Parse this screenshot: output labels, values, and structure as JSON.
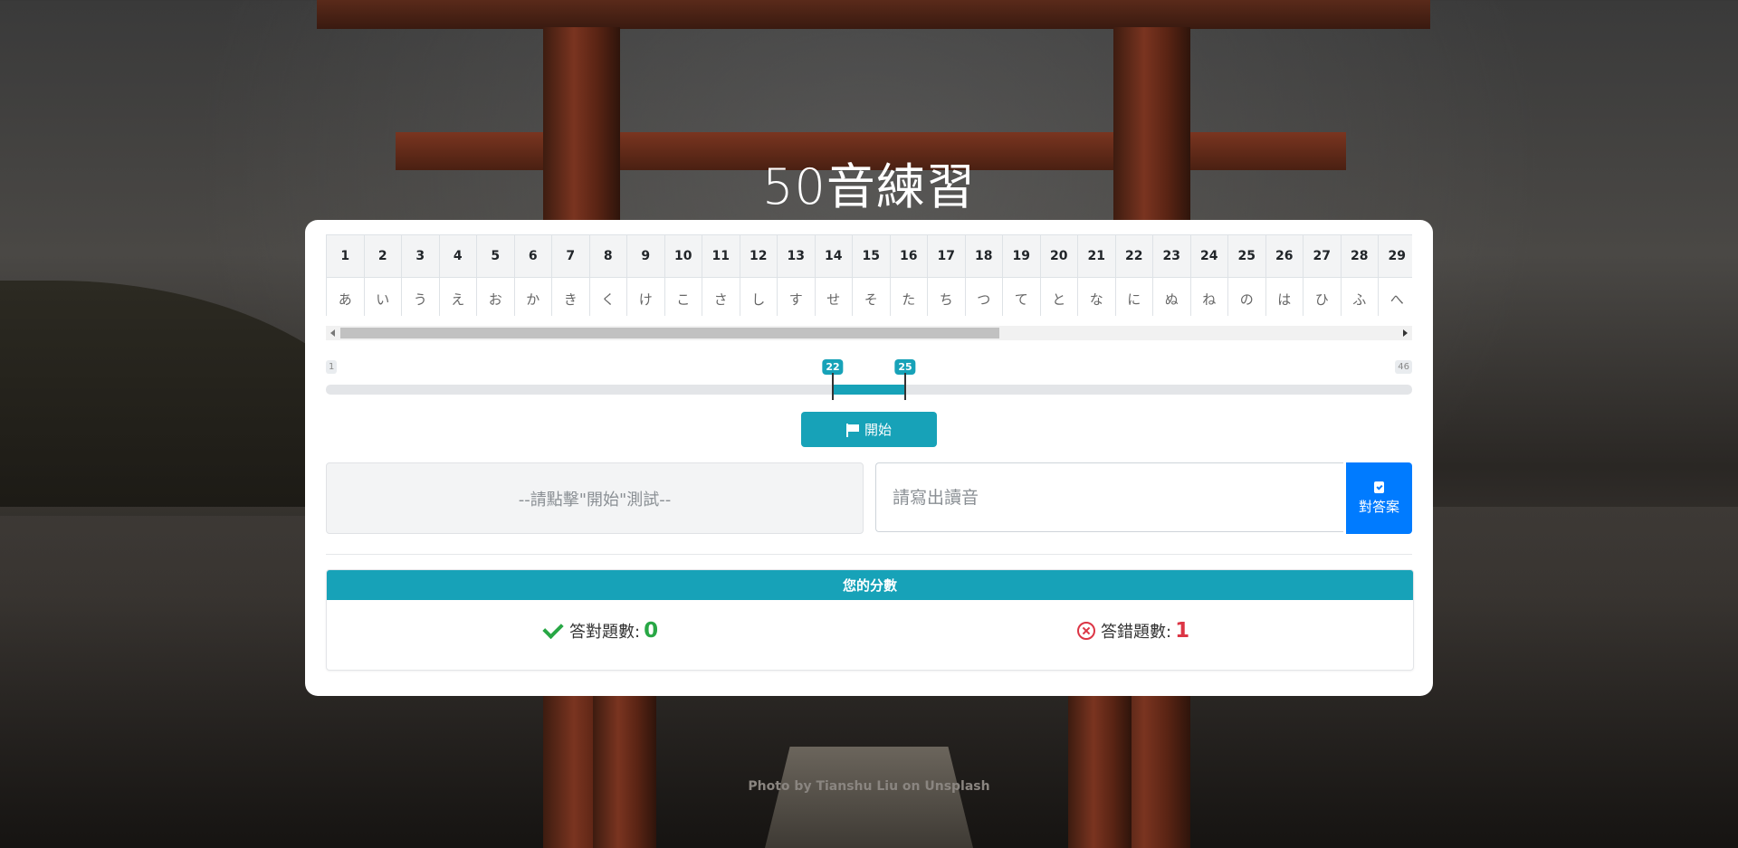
{
  "page": {
    "title": "50音練習",
    "photo_credit": "Photo by Tianshu Liu on Unsplash"
  },
  "kana_table": {
    "numbers": [
      "1",
      "2",
      "3",
      "4",
      "5",
      "6",
      "7",
      "8",
      "9",
      "10",
      "11",
      "12",
      "13",
      "14",
      "15",
      "16",
      "17",
      "18",
      "19",
      "20",
      "21",
      "22",
      "23",
      "24",
      "25",
      "26",
      "27",
      "28",
      "29"
    ],
    "kana": [
      "あ",
      "い",
      "う",
      "え",
      "お",
      "か",
      "き",
      "く",
      "け",
      "こ",
      "さ",
      "し",
      "す",
      "せ",
      "そ",
      "た",
      "ち",
      "つ",
      "て",
      "と",
      "な",
      "に",
      "ぬ",
      "ね",
      "の",
      "は",
      "ひ",
      "ふ",
      "へ"
    ]
  },
  "range_slider": {
    "min_label": "1",
    "max_label": "46",
    "min": 1,
    "max": 46,
    "from": 22,
    "to": 25,
    "from_label": "22",
    "to_label": "25"
  },
  "start_button": {
    "label": "開始",
    "icon": "flag-icon"
  },
  "question": {
    "text": "--請點擊\"開始\"測試--"
  },
  "answer": {
    "placeholder": "請寫出讀音",
    "value": "",
    "submit_label": "對答案",
    "submit_icon": "clipboard-check-icon"
  },
  "score": {
    "header": "您的分數",
    "correct_label": "答對題數:",
    "correct_value": "0",
    "wrong_label": "答錯題數:",
    "wrong_value": "1"
  },
  "colors": {
    "accent": "#17a2b8",
    "primary": "#007bff",
    "success": "#28a745",
    "danger": "#dc3545"
  }
}
